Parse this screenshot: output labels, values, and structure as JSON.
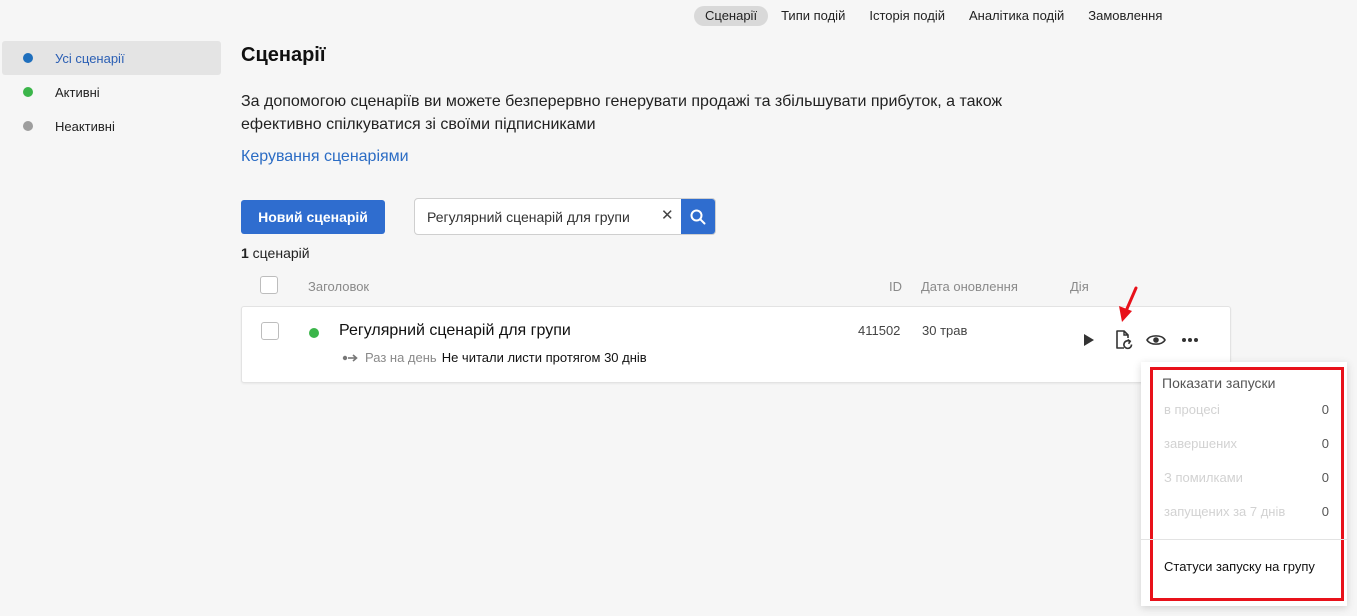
{
  "topnav": {
    "items": [
      {
        "label": "Сценарії",
        "active": true
      },
      {
        "label": "Типи подій"
      },
      {
        "label": "Історія подій"
      },
      {
        "label": "Аналітика подій"
      },
      {
        "label": "Замовлення"
      }
    ]
  },
  "sidebar": {
    "items": [
      {
        "label": "Усі сценарії",
        "dot_color": "#1f6fbd",
        "active": true
      },
      {
        "label": "Активні",
        "dot_color": "#3bb54a"
      },
      {
        "label": "Неактивні",
        "dot_color": "#9e9e9e"
      }
    ]
  },
  "main": {
    "title": "Сценарії",
    "description": "За допомогою сценаріїв ви можете безперервно генерувати продажі та збільшувати прибуток, а також ефективно спілкуватися зі своїми підписниками",
    "manage_link": "Керування сценаріями",
    "new_button": "Новий сценарій",
    "search": {
      "value": "Регулярний сценарій для групи",
      "clear": "✕"
    },
    "count_number": "1",
    "count_label": " сценарій"
  },
  "table": {
    "columns": {
      "title": "Заголовок",
      "id": "ID",
      "updated": "Дата оновлення",
      "action": "Дія"
    },
    "rows": [
      {
        "status_color": "#3bb54a",
        "title": "Регулярний сценарій для групи",
        "frequency": "Раз на день",
        "condition": "Не читали листи протягом 30 днів",
        "id": "411502",
        "updated": "30 трав"
      }
    ]
  },
  "dropdown": {
    "title": "Показати запуски",
    "items": [
      {
        "label": "в процесі",
        "count": "0"
      },
      {
        "label": "завершених",
        "count": "0"
      },
      {
        "label": "З помилками",
        "count": "0"
      },
      {
        "label": "запущених за 7 днів",
        "count": "0"
      }
    ],
    "footer": "Статуси запуску на групу"
  },
  "colors": {
    "accent": "#2f6dcf",
    "link": "#2b6cc4",
    "highlight": "#e8111a"
  }
}
